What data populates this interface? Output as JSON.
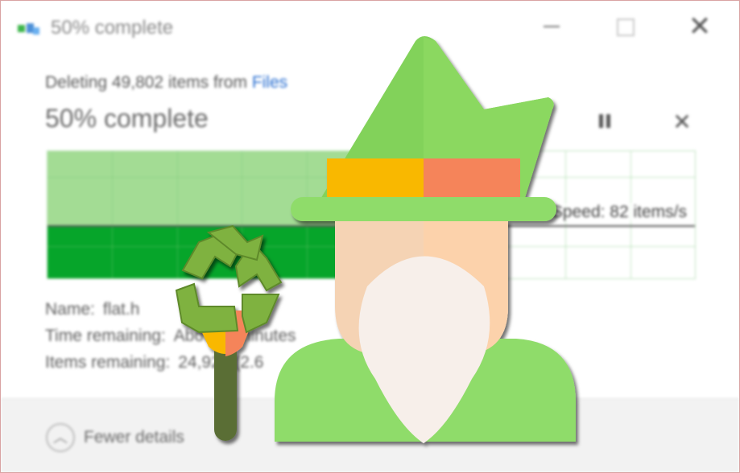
{
  "window": {
    "title": "50% complete",
    "icon": "recycle-bin-icon",
    "controls": {
      "minimize": "minimize-icon",
      "maximize": "maximize-icon",
      "close": "close-icon",
      "close_glyph": "✕"
    }
  },
  "operation": {
    "deleting_prefix": "Deleting 49,802 items from",
    "source_link": "Files",
    "status": "50% complete",
    "percent": 50,
    "pause": "pause-icon",
    "cancel_glyph": "✕"
  },
  "graph": {
    "speed_label": "Speed: 82 items/s"
  },
  "details": {
    "name_label": "Name:",
    "name_value": "flat.h",
    "time_label": "Time remaining:",
    "time_value": "About 3 minutes",
    "items_label": "Items remaining:",
    "items_value": "24,923 (2.6"
  },
  "footer": {
    "toggle_label": "Fewer details",
    "toggle_icon": "chevron-up-icon"
  },
  "overlay": {
    "wizard": "wizard-icon",
    "staff": "recycle-staff-icon"
  },
  "colors": {
    "progress_dark": "#06a52a",
    "progress_light": "#a3dc94",
    "link": "#2a6fd1",
    "hat": "#82d25a",
    "hat_band_yellow": "#f9b800",
    "hat_band_orange": "#f5845a",
    "beard": "#f7efea",
    "skin": "#f5d3b4"
  }
}
